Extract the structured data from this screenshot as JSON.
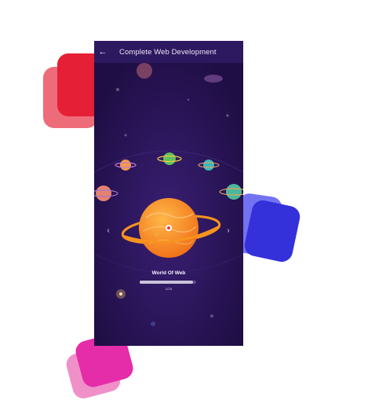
{
  "app_bar": {
    "back_icon": "arrow-left-icon",
    "title": "Complete Web Development"
  },
  "main": {
    "planet_name": "World Of Web",
    "progress_text": "1/15",
    "progress_fraction": 0.95,
    "nav_prev_icon": "chevron-left-icon",
    "nav_next_icon": "chevron-right-icon"
  },
  "colors": {
    "phone_bg": "#2b1458",
    "app_bar_bg": "#2d1960",
    "planet_orange": "#f7941d",
    "deco_red": "#e51f36",
    "deco_blue": "#3431db",
    "deco_pink": "#e52ca9"
  }
}
